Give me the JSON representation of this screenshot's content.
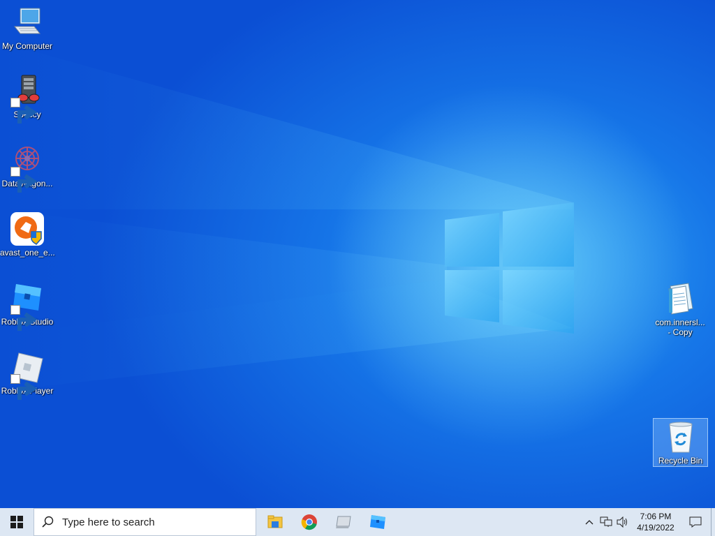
{
  "desktop": {
    "icons": [
      {
        "label": "My Computer",
        "icon": "computer-icon",
        "shortcut": false
      },
      {
        "label": "Speccy",
        "icon": "speccy-icon",
        "shortcut": true
      },
      {
        "label": "DataWagon...",
        "icon": "datawagon-icon",
        "shortcut": true
      },
      {
        "label": "avast_one_e...",
        "icon": "avast-icon",
        "shortcut": false
      },
      {
        "label": "Roblox Studio",
        "icon": "roblox-studio-icon",
        "shortcut": true
      },
      {
        "label": "Roblox Player",
        "icon": "roblox-player-icon",
        "shortcut": true
      }
    ],
    "right_icons": [
      {
        "label_line1": "com.innersl...",
        "label_line2": "- Copy",
        "icon": "notepad-file-icon"
      },
      {
        "label": "Recycle Bin",
        "icon": "recycle-bin-icon",
        "selected": true
      }
    ]
  },
  "taskbar": {
    "start_icon": "windows-logo-icon",
    "search_placeholder": "Type here to search",
    "pinned": [
      "file-explorer-icon",
      "chrome-icon",
      "drive-icon",
      "roblox-studio-icon"
    ],
    "tray": {
      "icons": [
        "chevron-up-icon",
        "network-icon",
        "volume-icon"
      ],
      "time": "7:06 PM",
      "date": "4/19/2022",
      "notification_icon": "notification-icon"
    }
  },
  "colors": {
    "wallpaper_accent": "#1676e8",
    "taskbar_bg": "#dde7f3"
  }
}
